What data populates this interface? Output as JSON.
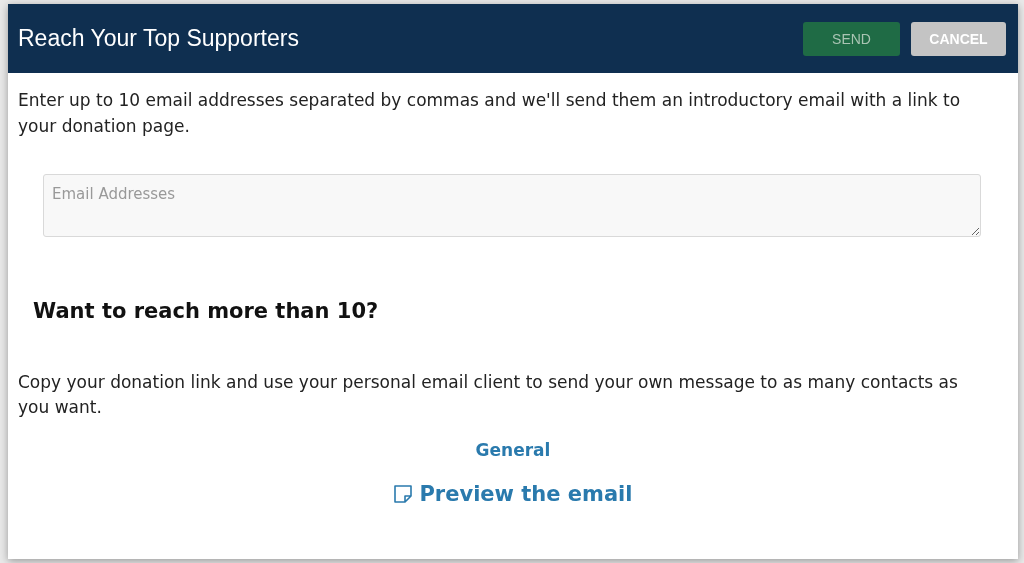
{
  "dialog": {
    "title": "Reach Your Top Supporters",
    "buttons": [
      {
        "label": "SEND",
        "kind": "primary"
      },
      {
        "label": "CANCEL",
        "kind": "secondary"
      }
    ],
    "intro": "Enter up to 10 email addresses separated by commas and we'll send them an introductory email with a link to your donation page.",
    "email_field": {
      "placeholder": "Email Addresses"
    },
    "more_heading": "Want to reach more than 10?",
    "more_text": "Copy your donation link and use your personal email client to send your own message to as many contacts as you want.",
    "link": "General",
    "preview_link": "Preview the email"
  }
}
